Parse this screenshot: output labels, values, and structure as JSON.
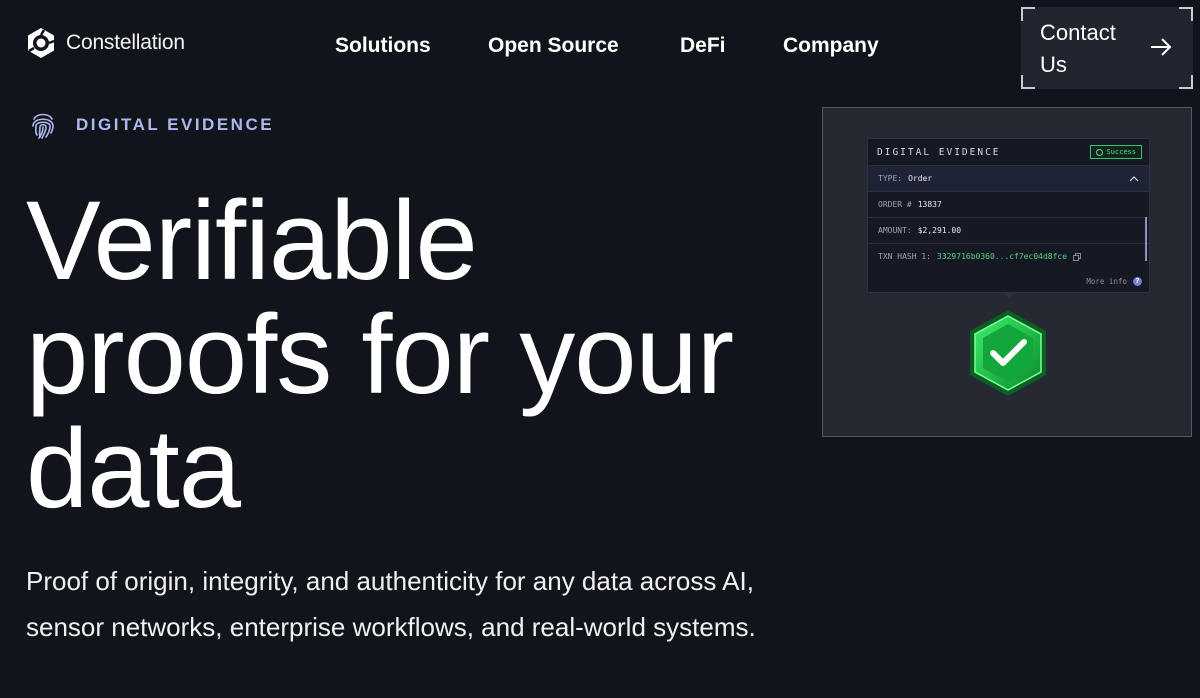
{
  "brand": {
    "name": "Constellation"
  },
  "nav": {
    "items": [
      "Solutions",
      "Open Source",
      "DeFi",
      "Company"
    ]
  },
  "contact": {
    "label": "Contact Us"
  },
  "eyebrow": {
    "text": "DIGITAL EVIDENCE"
  },
  "hero": {
    "title": "Verifiable\nproofs for your\ndata",
    "subtitle": "Proof of origin, integrity, and authenticity for any data across AI, sensor networks, enterprise workflows, and real-world systems."
  },
  "card": {
    "title": "DIGITAL EVIDENCE",
    "status": "Success",
    "type_label": "TYPE:",
    "type_value": "Order",
    "order_label": "ORDER #",
    "order_value": "13837",
    "amount_label": "AMOUNT:",
    "amount_value": "$2,291.00",
    "hash_label": "TXN HASH 1:",
    "hash_value": "3329716b0360...cf7ec04d8fce",
    "more_info": "More info"
  },
  "colors": {
    "background": "#12141c",
    "accent": "#aeb8ef",
    "success": "#4ee08a"
  }
}
